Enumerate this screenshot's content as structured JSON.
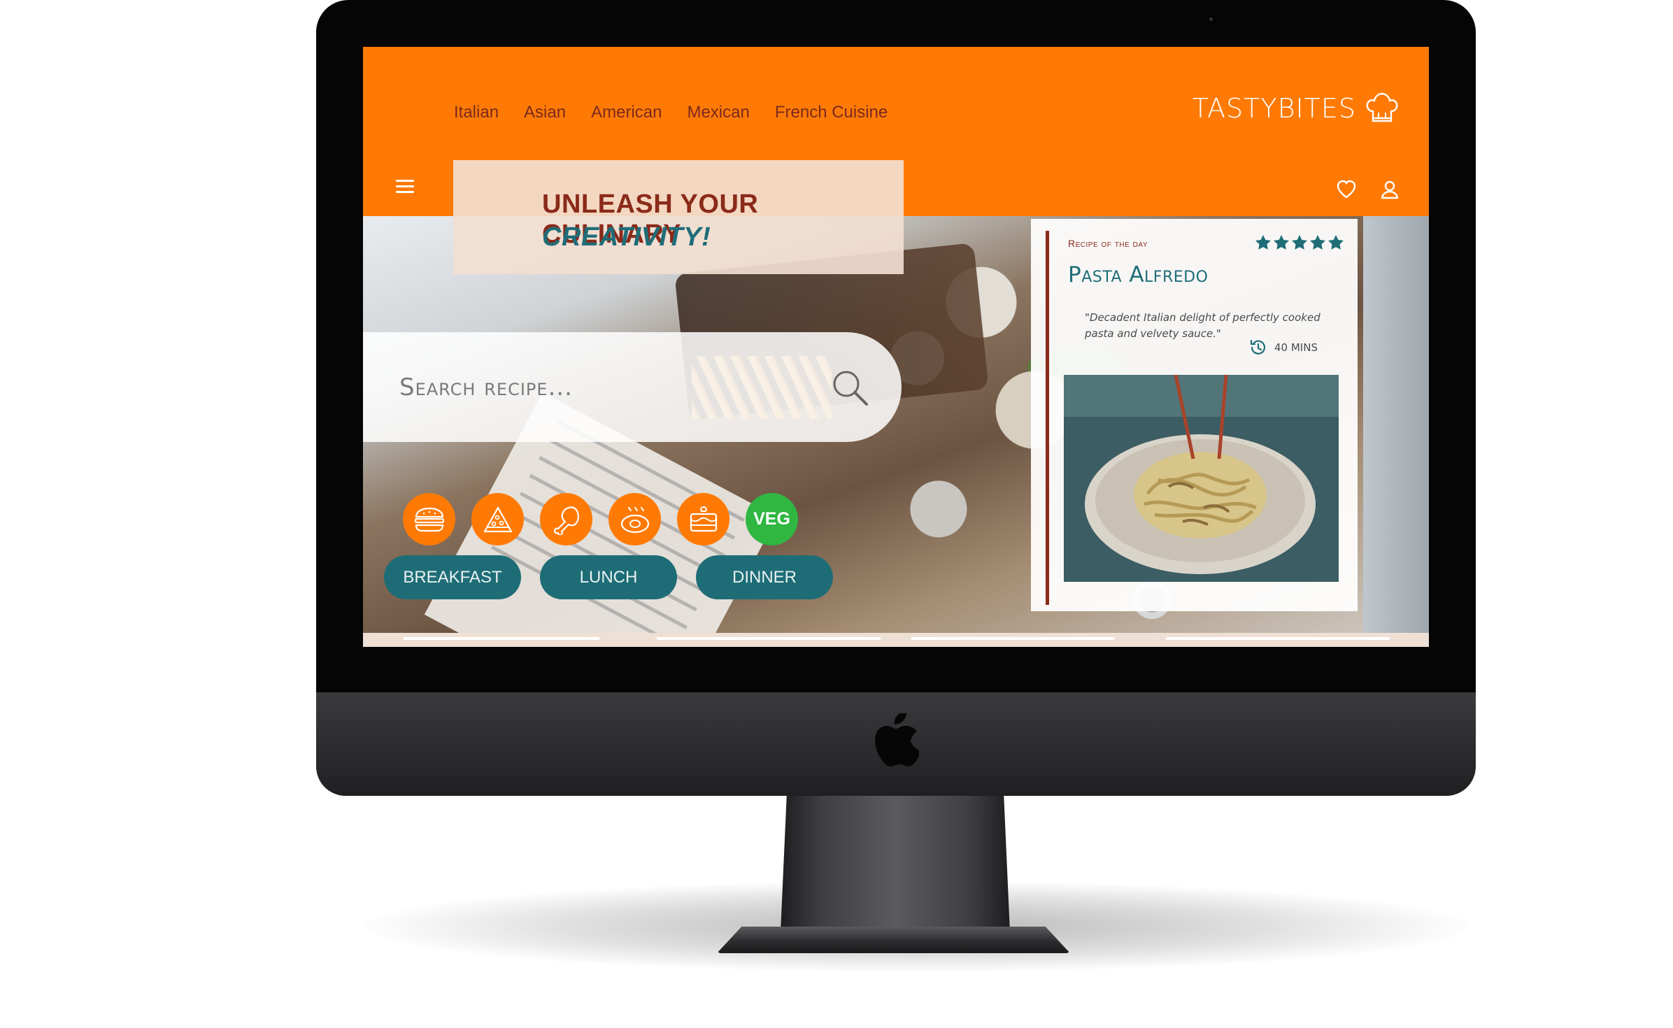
{
  "nav": {
    "links": [
      "Italian",
      "Asian",
      "American",
      "Mexican",
      "French Cuisine"
    ]
  },
  "brand": {
    "name": "TASTYBITES",
    "icon": "chef-hat-icon"
  },
  "header_icons": [
    "menu-icon",
    "heart-icon",
    "user-icon"
  ],
  "hero": {
    "headline_line1": "UNLEASH YOUR CULINARY",
    "headline_line2": "CREATIVITY!"
  },
  "search": {
    "placeholder": "Search recipe...",
    "icon": "search-icon"
  },
  "categories": [
    {
      "icon": "burger-icon"
    },
    {
      "icon": "pizza-icon"
    },
    {
      "icon": "chicken-leg-icon"
    },
    {
      "icon": "steak-icon"
    },
    {
      "icon": "cake-icon"
    },
    {
      "label": "VEG"
    }
  ],
  "meals": [
    "BREAKFAST",
    "LUNCH",
    "DINNER"
  ],
  "recipe_of_day": {
    "eyebrow": "Recipe of the day",
    "title": "Pasta Alfredo",
    "rating": 5,
    "rating_max": 5,
    "quote": "\"Decadent Italian delight of perfectly cooked pasta and velvety sauce.\"",
    "time": "40 MINS",
    "time_icon": "clock-icon"
  },
  "colors": {
    "orange": "#ff7a05",
    "teal": "#1e6d76",
    "maroon": "#8b2a1a",
    "green": "#2fb742",
    "headline_bg": "#f2ded0"
  }
}
